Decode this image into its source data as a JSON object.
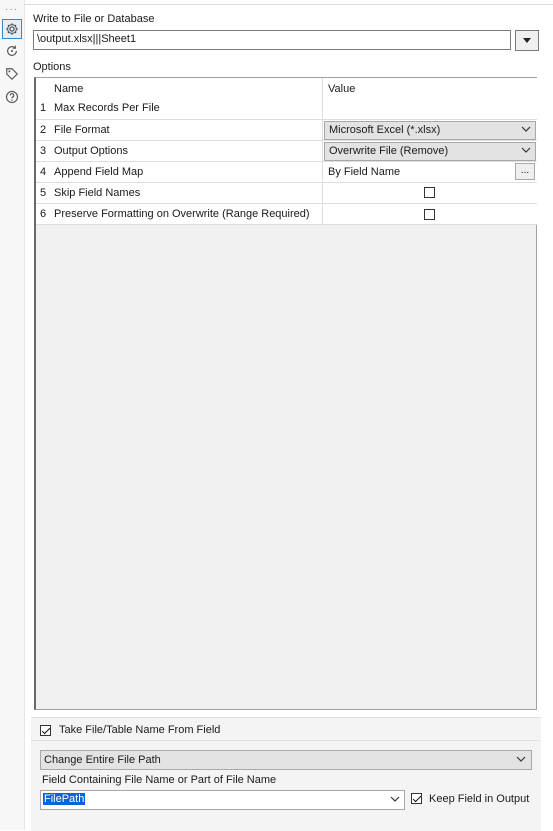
{
  "rail": {
    "icons": [
      "gear-icon",
      "refresh-icon",
      "tag-icon",
      "help-icon"
    ]
  },
  "write_section": {
    "label": "Write to File or Database",
    "path_value": "\\output.xlsx|||Sheet1"
  },
  "options": {
    "label": "Options",
    "columns": {
      "name": "Name",
      "value": "Value"
    },
    "rows": [
      {
        "num": "1",
        "name": "Max Records Per File",
        "value": ""
      },
      {
        "num": "2",
        "name": "File Format",
        "value": "Microsoft Excel (*.xlsx)"
      },
      {
        "num": "3",
        "name": "Output Options",
        "value": "Overwrite File (Remove)"
      },
      {
        "num": "4",
        "name": "Append Field Map",
        "value": "By Field Name",
        "button": "..."
      },
      {
        "num": "5",
        "name": "Skip Field Names",
        "checked": false
      },
      {
        "num": "6",
        "name": "Preserve Formatting on Overwrite (Range Required)",
        "checked": false
      }
    ]
  },
  "bottom": {
    "take_name_label": "Take File/Table Name From Field",
    "take_name_checked": true,
    "mode_value": "Change Entire File Path",
    "field_label": "Field Containing File Name or Part of File Name",
    "field_value": "FilePath",
    "keep_label": "Keep Field in Output",
    "keep_checked": true
  }
}
